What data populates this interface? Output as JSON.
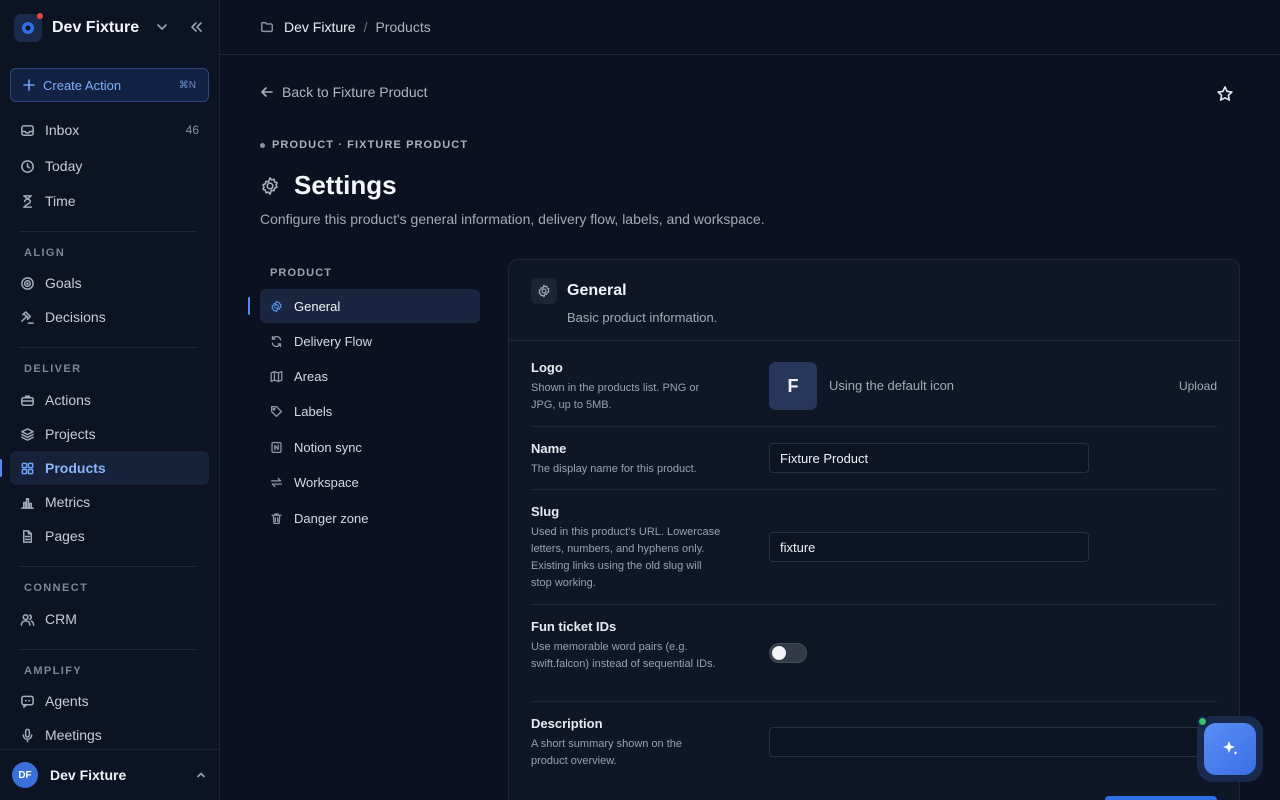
{
  "workspace": {
    "name": "Dev Fixture"
  },
  "create_action": {
    "label": "Create Action",
    "shortcut": "⌘N"
  },
  "nav": {
    "top": [
      {
        "label": "Inbox",
        "count": "46",
        "icon": "inbox-icon"
      },
      {
        "label": "Today",
        "icon": "clock-icon"
      },
      {
        "label": "Time",
        "icon": "hourglass-icon"
      }
    ],
    "sections": {
      "align": "ALIGN",
      "deliver": "DELIVER",
      "connect": "CONNECT",
      "amplify": "AMPLIFY"
    },
    "align": [
      {
        "label": "Goals",
        "icon": "target-icon"
      },
      {
        "label": "Decisions",
        "icon": "gavel-icon"
      }
    ],
    "deliver": [
      {
        "label": "Actions",
        "icon": "briefcase-icon"
      },
      {
        "label": "Projects",
        "icon": "layers-icon"
      },
      {
        "label": "Products",
        "icon": "grid-icon",
        "active": true
      },
      {
        "label": "Metrics",
        "icon": "bar-chart-icon"
      },
      {
        "label": "Pages",
        "icon": "file-icon"
      }
    ],
    "connect": [
      {
        "label": "CRM",
        "icon": "users-icon"
      }
    ],
    "amplify": [
      {
        "label": "Agents",
        "icon": "chat-bot-icon"
      },
      {
        "label": "Meetings",
        "icon": "microphone-icon"
      }
    ]
  },
  "user": {
    "initials": "DF",
    "name": "Dev Fixture"
  },
  "breadcrumb": {
    "root": "Dev Fixture",
    "separator": "/",
    "current": "Products"
  },
  "back": {
    "label": "Back to Fixture Product"
  },
  "eyebrow": "PRODUCT · FIXTURE PRODUCT",
  "page": {
    "title": "Settings",
    "description": "Configure this product's general information, delivery flow, labels, and workspace."
  },
  "subnav": {
    "heading": "PRODUCT",
    "items": [
      {
        "label": "General",
        "icon": "gear-icon",
        "active": true
      },
      {
        "label": "Delivery Flow",
        "icon": "refresh-icon"
      },
      {
        "label": "Areas",
        "icon": "map-icon"
      },
      {
        "label": "Labels",
        "icon": "tag-icon"
      },
      {
        "label": "Notion sync",
        "icon": "notion-icon"
      },
      {
        "label": "Workspace",
        "icon": "swap-icon"
      },
      {
        "label": "Danger zone",
        "icon": "trash-icon"
      }
    ]
  },
  "general": {
    "title": "General",
    "subtitle": "Basic product information.",
    "logo": {
      "label": "Logo",
      "help": "Shown in the products list. PNG or JPG, up to 5MB.",
      "letter": "F",
      "note": "Using the default icon",
      "upload": "Upload"
    },
    "name": {
      "label": "Name",
      "help": "The display name for this product.",
      "value": "Fixture Product"
    },
    "slug": {
      "label": "Slug",
      "help": "Used in this product's URL. Lowercase letters, numbers, and hyphens only. Existing links using the old slug will stop working.",
      "value": "fixture"
    },
    "fun_ids": {
      "label": "Fun ticket IDs",
      "help": "Use memorable word pairs (e.g. swift.falcon) instead of sequential IDs.",
      "enabled": false
    },
    "description": {
      "label": "Description",
      "help": "A short summary shown on the product overview.",
      "value": ""
    }
  },
  "colors": {
    "accent": "#4f8cf7",
    "background": "#0b1120",
    "status_online": "#35c26b"
  }
}
